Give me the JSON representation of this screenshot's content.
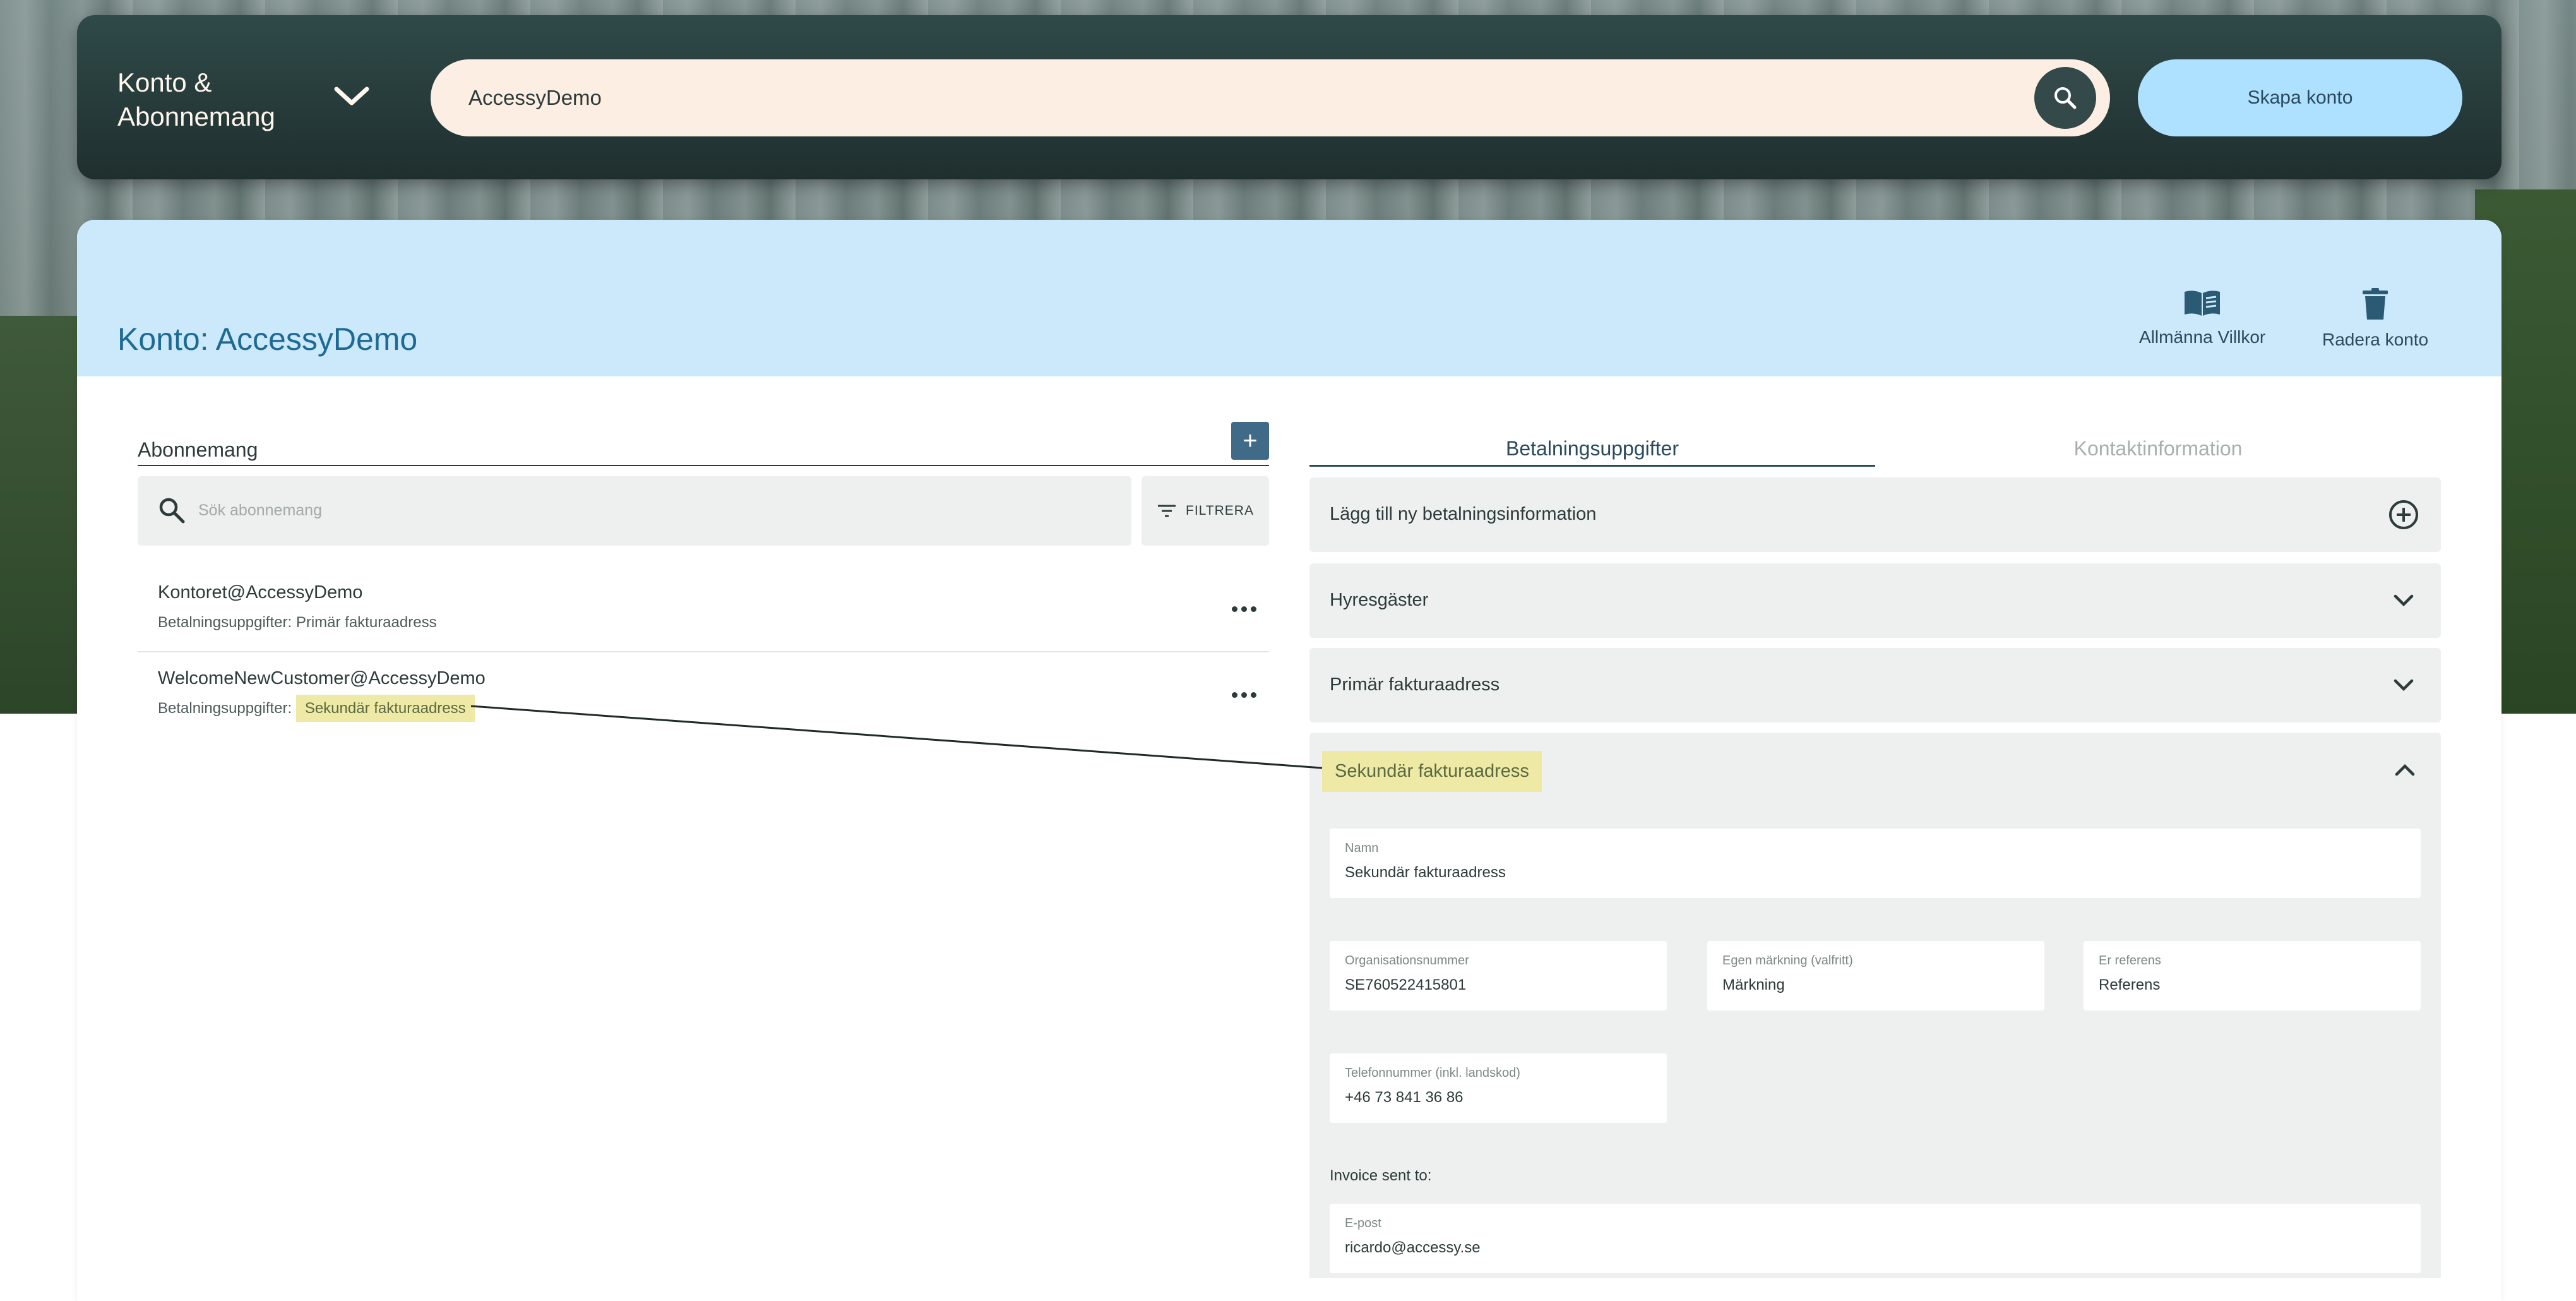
{
  "topbar": {
    "brand": "Konto & Abonnemang",
    "search_value": "AccessyDemo",
    "create_button": "Skapa konto"
  },
  "account": {
    "title": "Konto: AccessyDemo",
    "actions": {
      "terms": "Allmänna Villkor",
      "delete": "Radera konto"
    }
  },
  "subscriptions": {
    "title": "Abonnemang",
    "add_label": "+",
    "search_placeholder": "Sök abonnemang",
    "filter_label": "FILTRERA",
    "items": [
      {
        "name": "Kontoret@AccessyDemo",
        "meta_prefix": "Betalningsuppgifter:",
        "meta_value": "Primär fakturaadress"
      },
      {
        "name": "WelcomeNewCustomer@AccessyDemo",
        "meta_prefix": "Betalningsuppgifter:",
        "meta_value": "Sekundär fakturaadress"
      }
    ]
  },
  "payment": {
    "tabs": [
      "Betalningsuppgifter",
      "Kontaktinformation"
    ],
    "add_new": "Lägg till ny betalningsinformation",
    "sections": [
      "Hyresgäster",
      "Primär fakturaadress"
    ],
    "expanded": {
      "title": "Sekundär fakturaadress",
      "fields": {
        "name": {
          "label": "Namn",
          "value": "Sekundär fakturaadress"
        },
        "org": {
          "label": "Organisationsnummer",
          "value": "SE760522415801"
        },
        "own_mark": {
          "label": "Egen märkning (valfritt)",
          "value": "Märkning"
        },
        "reference": {
          "label": "Er referens",
          "value": "Referens"
        },
        "phone": {
          "label": "Telefonnummer (inkl. landskod)",
          "value": "+46 73 841 36 86"
        },
        "email": {
          "label": "E-post",
          "value": "ricardo@accessy.se"
        }
      },
      "invoice_sent_to": "Invoice sent to:"
    }
  },
  "colors": {
    "topbar": "#2f4a49",
    "search_bg": "#fdeee3",
    "create_btn": "#aee0ff",
    "header_bg": "#cbe9fb",
    "title": "#1e6a93",
    "highlight": "#efe9a6",
    "panel": "#eef0ef"
  }
}
